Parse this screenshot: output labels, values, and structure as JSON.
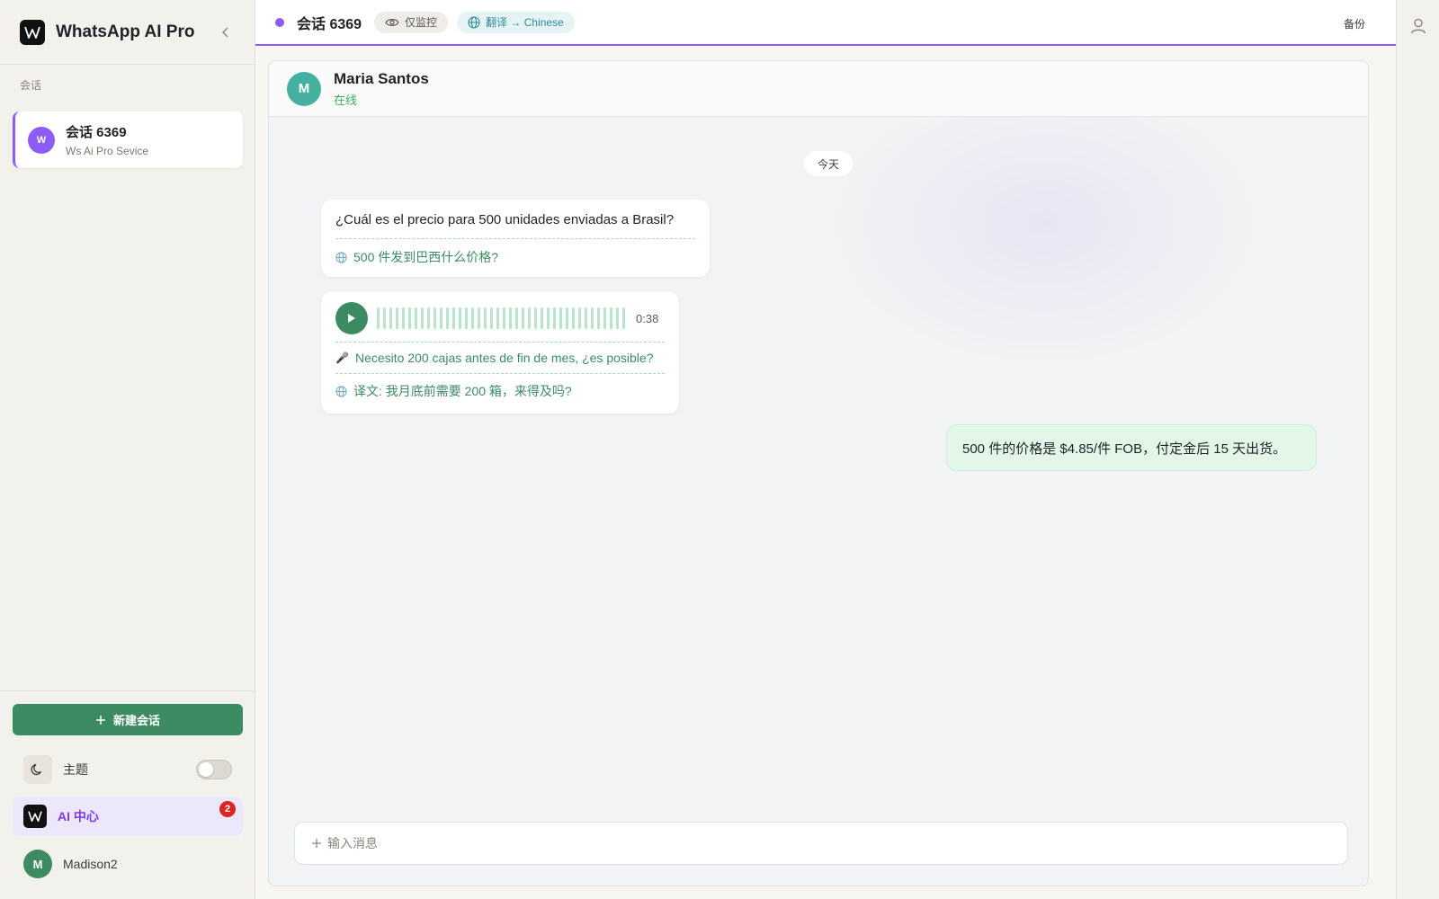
{
  "app": {
    "title": "WhatsApp AI Pro"
  },
  "sidebar": {
    "section_label": "会话",
    "conversations": [
      {
        "avatar": "W",
        "name": "会话 6369",
        "subtitle": "Ws Ai Pro Sevice"
      }
    ],
    "new_button_label": "新建会话",
    "theme_label": "主题",
    "ai_center": {
      "label": "AI 中心",
      "badge": "2"
    },
    "user": {
      "avatar": "M",
      "name": "Madison2"
    }
  },
  "topbar": {
    "title": "会话 6369",
    "monitor_label": "仅监控",
    "translate_label": "翻译 → Chinese",
    "backup_label": "备份"
  },
  "chat": {
    "contact": {
      "avatar": "M",
      "name": "Maria Santos",
      "status": "在线"
    },
    "date_label": "今天",
    "messages": [
      {
        "text": "¿Cuál es el precio para 500 unidades enviadas a Brasil?",
        "translation": "500 件发到巴西什么价格?"
      },
      {
        "duration": "0:38",
        "transcript": "Necesito 200 cajas antes de fin de mes, ¿es posible?",
        "translation": "译文: 我月底前需要 200 箱，来得及吗?"
      },
      {
        "text": "500 件的价格是 $4.85/件 FOB，付定金后 15 天出货。"
      }
    ],
    "input_placeholder": "输入消息"
  },
  "colors": {
    "accent": "#8b5cf6",
    "primary": "#3d8b63",
    "badge": "#dc2626",
    "online": "#3fae5f"
  },
  "icons": [
    "collapse-chevron-icon",
    "moon-icon",
    "eye-icon",
    "globe-icon",
    "play-icon",
    "mic-icon",
    "plus-icon",
    "user-icon"
  ]
}
